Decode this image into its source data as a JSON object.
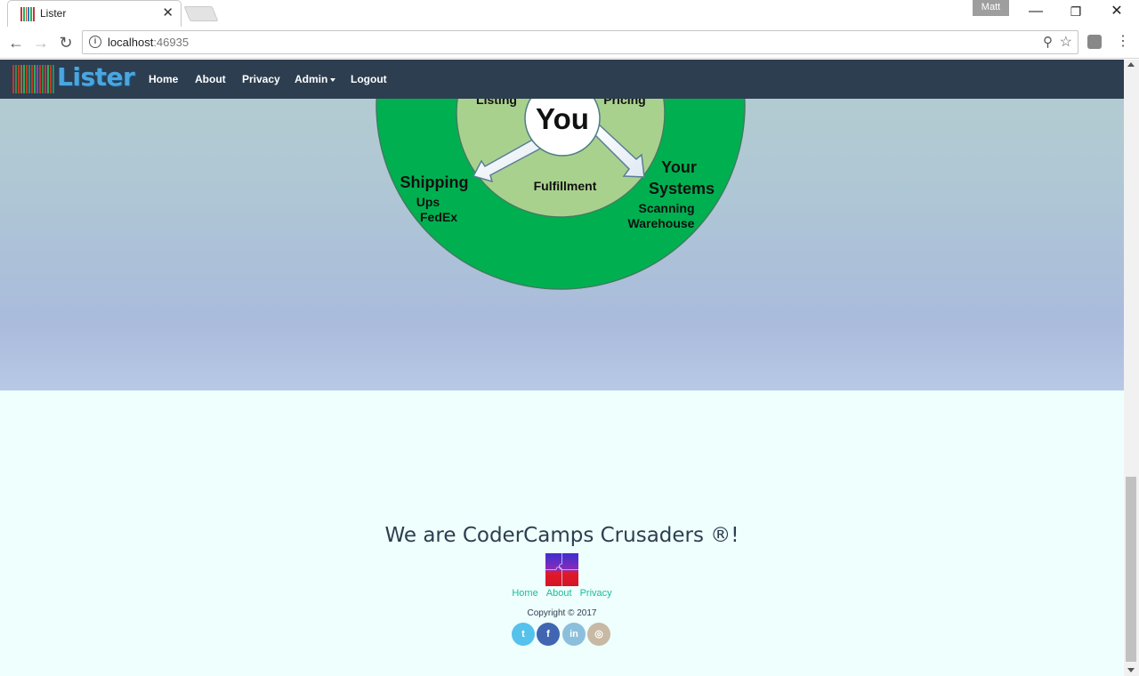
{
  "browser": {
    "tab_title": "Lister",
    "tab_close": "✕",
    "profile_name": "Matt",
    "url_host": "localhost",
    "url_port": ":46935",
    "window_controls": [
      "minimize",
      "restore",
      "close"
    ]
  },
  "navbar": {
    "brand": "Lister",
    "links": [
      "Home",
      "About",
      "Privacy",
      "Admin",
      "Logout"
    ]
  },
  "diagram": {
    "center": "You",
    "inner_labels": [
      "Listing",
      "Pricing",
      "Fulfillment"
    ],
    "outer_left_title": "Shipping",
    "outer_left_items": [
      "Ups",
      "FedEx"
    ],
    "outer_right_title_1": "Your",
    "outer_right_title_2": "Systems",
    "outer_right_items": [
      "Scanning",
      "Warehouse"
    ],
    "colors": {
      "outer_ring": "#00b050",
      "inner_ring": "#a9d18e",
      "center": "#ffffff"
    }
  },
  "footer": {
    "slogan": "We are CoderCamps Crusaders ®!",
    "links": [
      "Home",
      "About",
      "Privacy"
    ],
    "copyright": "Copyright © 2017",
    "socials": [
      {
        "name": "twitter-icon",
        "glyph": "t",
        "color": "#55c2ec"
      },
      {
        "name": "facebook-icon",
        "glyph": "f",
        "color": "#4066b1"
      },
      {
        "name": "linkedin-icon",
        "glyph": "in",
        "color": "#8bbfdc"
      },
      {
        "name": "instagram-icon",
        "glyph": "◎",
        "color": "#c7b9a3"
      }
    ]
  }
}
